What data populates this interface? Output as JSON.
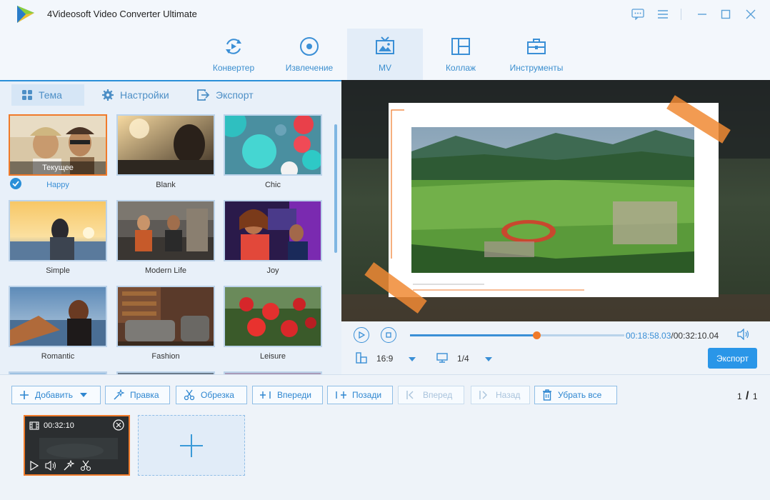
{
  "app": {
    "title": "4Videosoft Video Converter Ultimate"
  },
  "colors": {
    "accent": "#2a8fd8",
    "selection": "#f07a2a",
    "background": "#eef3f9"
  },
  "window_controls": [
    "feedback-icon",
    "menu-icon",
    "minimize-icon",
    "maximize-icon",
    "close-icon"
  ],
  "nav": {
    "tabs": [
      {
        "label": "Конвертер",
        "icon": "converter-icon",
        "active": false
      },
      {
        "label": "Извлечение",
        "icon": "ripper-icon",
        "active": false
      },
      {
        "label": "MV",
        "icon": "mv-icon",
        "active": true
      },
      {
        "label": "Коллаж",
        "icon": "collage-icon",
        "active": false
      },
      {
        "label": "Инструменты",
        "icon": "toolbox-icon",
        "active": false
      }
    ]
  },
  "subtabs": [
    {
      "label": "Тема",
      "icon": "grid-icon",
      "active": true
    },
    {
      "label": "Настройки",
      "icon": "gear-icon",
      "active": false
    },
    {
      "label": "Экспорт",
      "icon": "export-icon",
      "active": false
    }
  ],
  "themes": {
    "current_label": "Текущее",
    "items": [
      {
        "name": "Happy",
        "selected": true
      },
      {
        "name": "Blank",
        "selected": false
      },
      {
        "name": "Chic",
        "selected": false
      },
      {
        "name": "Simple",
        "selected": false
      },
      {
        "name": "Modern Life",
        "selected": false
      },
      {
        "name": "Joy",
        "selected": false
      },
      {
        "name": "Romantic",
        "selected": false
      },
      {
        "name": "Fashion",
        "selected": false
      },
      {
        "name": "Leisure",
        "selected": false
      }
    ]
  },
  "player": {
    "current_time": "00:18:58.03",
    "total_time": "/00:32:10.04",
    "progress": 0.59,
    "aspect_ratio": "16:9",
    "screen": "1/4",
    "export_label": "Экспорт"
  },
  "toolbar": {
    "add": "Добавить",
    "edit": "Правка",
    "trim": "Обрезка",
    "ahead": "Впереди",
    "behind": "Позади",
    "forward": "Вперед",
    "backward": "Назад",
    "remove_all": "Убрать все",
    "page_current": "1",
    "page_total": "1"
  },
  "clip": {
    "duration": "00:32:10"
  }
}
